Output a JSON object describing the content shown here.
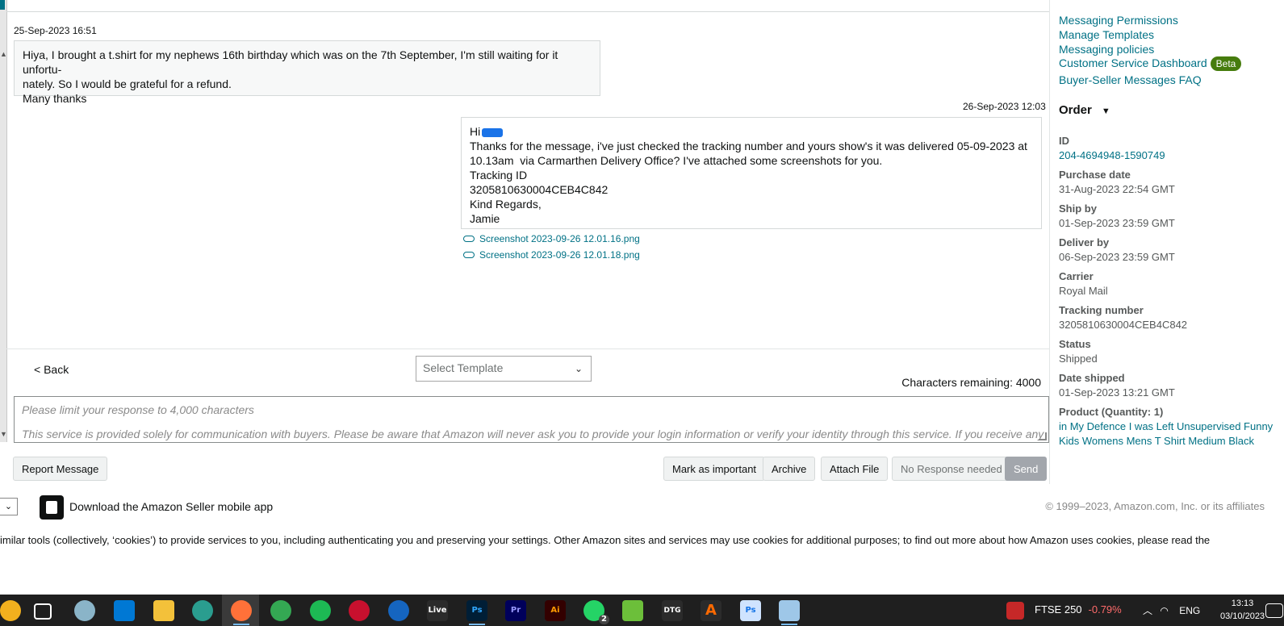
{
  "thread": {
    "incoming": {
      "timestamp": "25-Sep-2023 16:51",
      "lines": [
        "Hiya, I brought a t.shirt for my nephews 16th birthday which was on the 7th September, I'm still waiting for it unfortu-",
        "nately. So I would be grateful for a refund.",
        "Many thanks"
      ]
    },
    "outgoing": {
      "timestamp": "26-Sep-2023 12:03",
      "greeting": "Hi",
      "lines": [
        "Thanks for the message, i've just checked the tracking number and yours show's it was delivered 05-09-2023 at",
        "10.13am  via Carmarthen Delivery Office? I've attached some screenshots for you.",
        "Tracking ID",
        "3205810630004CEB4C842",
        "Kind Regards,",
        "Jamie"
      ],
      "attachments": [
        "Screenshot 2023-09-26 12.01.16.png",
        "Screenshot 2023-09-26 12.01.18.png"
      ]
    }
  },
  "compose": {
    "back_label": "< Back",
    "template_placeholder": "Select Template",
    "chars_remaining": "Characters remaining: 4000",
    "placeholder_1": "Please limit your response to 4,000 characters",
    "placeholder_2": "This service is provided solely for communication with buyers. Please be aware that Amazon will never ask you to provide your login information or verify your identity through this service. If you receive any"
  },
  "actions": {
    "report": "Report Message",
    "mark_important": "Mark as important",
    "archive": "Archive",
    "attach": "Attach File",
    "no_response": "No Response needed",
    "send": "Send"
  },
  "side": {
    "links": [
      "Messaging Permissions",
      "Manage Templates",
      "Messaging policies",
      "Customer Service Dashboard",
      "Buyer-Seller Messages FAQ"
    ],
    "beta_label": "Beta",
    "order_heading": "Order",
    "order": {
      "id_label": "ID",
      "id_value": "204-4694948-1590749",
      "purchase_label": "Purchase date",
      "purchase_value": "31-Aug-2023 22:54 GMT",
      "shipby_label": "Ship by",
      "shipby_value": "01-Sep-2023 23:59 GMT",
      "deliverby_label": "Deliver by",
      "deliverby_value": "06-Sep-2023 23:59 GMT",
      "carrier_label": "Carrier",
      "carrier_value": "Royal Mail",
      "tracking_label": "Tracking number",
      "tracking_value": "3205810630004CEB4C842",
      "status_label": "Status",
      "status_value": "Shipped",
      "shipped_label": "Date shipped",
      "shipped_value": "01-Sep-2023 13:21 GMT",
      "product_label": "Product (Quantity: 1)",
      "product_line1": "in My Defence I was Left Unsupervised Funny",
      "product_line2": "Kids Womens Mens T Shirt Medium Black"
    }
  },
  "footer": {
    "app_text": "Download the Amazon Seller mobile app",
    "copyright": "© 1999–2023, Amazon.com, Inc. or its affiliates",
    "cookie": "imilar tools (collectively, ‘cookies’) to provide services to you, including authenticating you and preserving your settings. Other Amazon sites and services may use cookies for additional purposes; to find out more about how Amazon uses cookies, please read the"
  },
  "taskbar": {
    "ftse_label": "FTSE 250",
    "ftse_change": "-0.79%",
    "lang": "ENG",
    "time": "13:13",
    "date": "03/10/2023",
    "whatsapp_badge": "2",
    "app_labels": {
      "live": "Live",
      "ps": "Ps",
      "pr": "Pr",
      "ai": "Ai",
      "dtg": "DTG"
    },
    "colors": {
      "ps": "#31a8ff",
      "pr": "#9999ff",
      "ai": "#ff9a00",
      "bg": "#1f1f1f"
    }
  }
}
